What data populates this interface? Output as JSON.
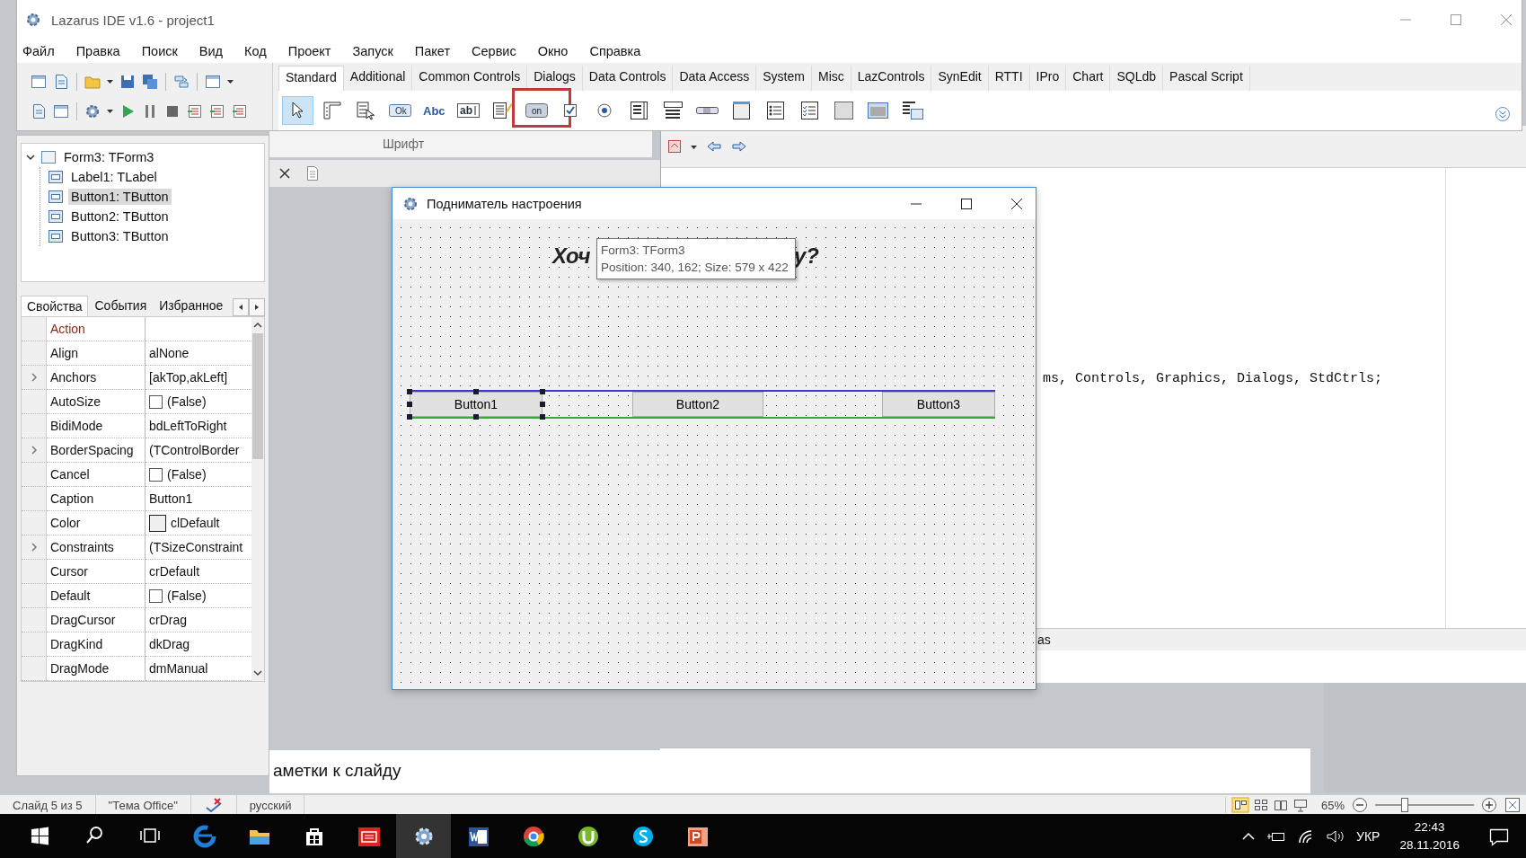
{
  "ide": {
    "title": "Lazarus IDE v1.6 - project1"
  },
  "menu": [
    "Файл",
    "Правка",
    "Поиск",
    "Вид",
    "Код",
    "Проект",
    "Запуск",
    "Пакет",
    "Сервис",
    "Окно",
    "Справка"
  ],
  "palette": {
    "tabs": [
      {
        "label": "Standard",
        "selected": true
      },
      {
        "label": "Additional",
        "selected": false
      },
      {
        "label": "Common Controls",
        "selected": false
      },
      {
        "label": "Dialogs",
        "selected": false
      },
      {
        "label": "Data Controls",
        "selected": false
      },
      {
        "label": "Data Access",
        "selected": false
      },
      {
        "label": "System",
        "selected": false
      },
      {
        "label": "Misc",
        "selected": false
      },
      {
        "label": "LazControls",
        "selected": false
      },
      {
        "label": "SynEdit",
        "selected": false
      },
      {
        "label": "RTTI",
        "selected": false
      },
      {
        "label": "IPro",
        "selected": false
      },
      {
        "label": "Chart",
        "selected": false
      },
      {
        "label": "SQLdb",
        "selected": false
      },
      {
        "label": "Pascal Script",
        "selected": false
      }
    ],
    "components": [
      {
        "kind": "pointer",
        "selected": true,
        "marked": false
      },
      {
        "kind": "menu",
        "selected": false,
        "marked": false
      },
      {
        "kind": "popup",
        "selected": false,
        "marked": false
      },
      {
        "kind": "button",
        "text": "Ok",
        "selected": false,
        "marked": false
      },
      {
        "kind": "label",
        "text": "Abc",
        "selected": false,
        "marked": false
      },
      {
        "kind": "edit",
        "text": "ab",
        "selected": false,
        "marked": false
      },
      {
        "kind": "memo",
        "selected": false,
        "marked": false
      },
      {
        "kind": "toggle",
        "text": "on",
        "selected": false,
        "marked": true
      },
      {
        "kind": "check",
        "selected": false,
        "marked": false
      },
      {
        "kind": "radio",
        "selected": false,
        "marked": false
      },
      {
        "kind": "listbox",
        "selected": false,
        "marked": false
      },
      {
        "kind": "combobox",
        "selected": false,
        "marked": false
      },
      {
        "kind": "scrollbar",
        "selected": false,
        "marked": false
      },
      {
        "kind": "groupbox",
        "selected": false,
        "marked": false
      },
      {
        "kind": "radiogroup",
        "selected": false,
        "marked": false
      },
      {
        "kind": "checkgroup",
        "selected": false,
        "marked": false
      },
      {
        "kind": "panel",
        "selected": false,
        "marked": false
      },
      {
        "kind": "frame",
        "selected": false,
        "marked": false
      },
      {
        "kind": "actionlist",
        "selected": false,
        "marked": false
      }
    ]
  },
  "ribbon_group": "Шрифт",
  "tree": [
    {
      "label": "Form3: TForm3",
      "selected": false,
      "expanded": true,
      "children": [
        {
          "label": "Label1: TLabel",
          "selected": false
        },
        {
          "label": "Button1: TButton",
          "selected": true
        },
        {
          "label": "Button2: TButton",
          "selected": false
        },
        {
          "label": "Button3: TButton",
          "selected": false
        }
      ]
    }
  ],
  "inspector_tabs": [
    {
      "label": "Свойства",
      "selected": true
    },
    {
      "label": "События",
      "selected": false
    },
    {
      "label": "Избранное",
      "selected": false
    }
  ],
  "properties": [
    {
      "name": "Action",
      "kind": "text",
      "expandable": false,
      "highlighted": true
    },
    {
      "name": "Align",
      "value": "alNone",
      "kind": "text",
      "expandable": false,
      "highlighted": false
    },
    {
      "name": "Anchors",
      "value": "[akTop,akLeft]",
      "kind": "text",
      "expandable": true,
      "highlighted": false
    },
    {
      "name": "AutoSize",
      "value": "(False)",
      "kind": "checkbox",
      "checked": false,
      "expandable": false,
      "highlighted": false
    },
    {
      "name": "BidiMode",
      "value": "bdLeftToRight",
      "kind": "text",
      "expandable": false,
      "highlighted": false
    },
    {
      "name": "BorderSpacing",
      "value": "(TControlBorder",
      "kind": "text",
      "expandable": true,
      "highlighted": false
    },
    {
      "name": "Cancel",
      "value": "(False)",
      "kind": "checkbox",
      "checked": false,
      "expandable": false,
      "highlighted": false
    },
    {
      "name": "Caption",
      "value": "Button1",
      "kind": "text",
      "expandable": false,
      "highlighted": false
    },
    {
      "name": "Color",
      "value": "clDefault",
      "kind": "color",
      "expandable": false,
      "highlighted": false
    },
    {
      "name": "Constraints",
      "value": "(TSizeConstraint",
      "kind": "text",
      "expandable": true,
      "highlighted": false
    },
    {
      "name": "Cursor",
      "value": "crDefault",
      "kind": "text",
      "expandable": false,
      "highlighted": false
    },
    {
      "name": "Default",
      "value": "(False)",
      "kind": "checkbox",
      "checked": false,
      "expandable": false,
      "highlighted": false
    },
    {
      "name": "DragCursor",
      "value": "crDrag",
      "kind": "text",
      "expandable": false,
      "highlighted": false
    },
    {
      "name": "DragKind",
      "value": "dkDrag",
      "kind": "text",
      "expandable": false,
      "highlighted": false
    },
    {
      "name": "DragMode",
      "value": "dmManual",
      "kind": "text",
      "expandable": false,
      "highlighted": false
    }
  ],
  "editor": {
    "code_line": "ms, Controls, Graphics, Dialogs, StdCtrls;",
    "message": "as"
  },
  "form": {
    "title": "Подниматель настроения",
    "label_parts": [
      "Хоч",
      "у?"
    ],
    "tooltip": [
      "Form3: TForm3",
      "Position: 340, 162; Size: 579 x 422"
    ],
    "buttons": [
      {
        "caption": "Button1",
        "selected": true
      },
      {
        "caption": "Button2",
        "selected": false
      },
      {
        "caption": "Button3",
        "selected": false
      }
    ]
  },
  "notes": "аметки к слайду",
  "status_bar": {
    "slide": "Слайд 5 из 5",
    "theme": "\"Тема Office\"",
    "language": "русский",
    "zoom": "65%",
    "zoom_slider": {
      "level": 0.3
    }
  },
  "tray": {
    "language": "УКР",
    "time": "22:43",
    "date": "28.11.2016"
  }
}
